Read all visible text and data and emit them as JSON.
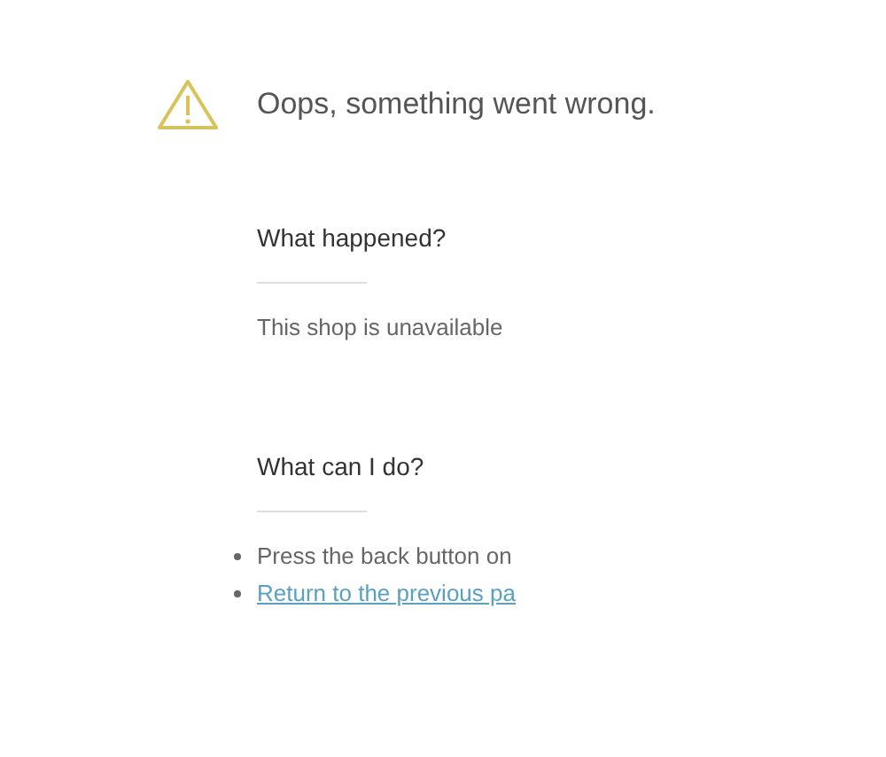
{
  "title": "Oops, something went wrong.",
  "sections": [
    {
      "heading": "What happened?",
      "items": [
        {
          "kind": "text",
          "text": "This shop is unavailable"
        }
      ]
    },
    {
      "heading": "What can I do?",
      "items": [
        {
          "kind": "bullet",
          "text": "Press the back button on"
        },
        {
          "kind": "link",
          "text": "Return to the previous pa"
        }
      ]
    }
  ]
}
